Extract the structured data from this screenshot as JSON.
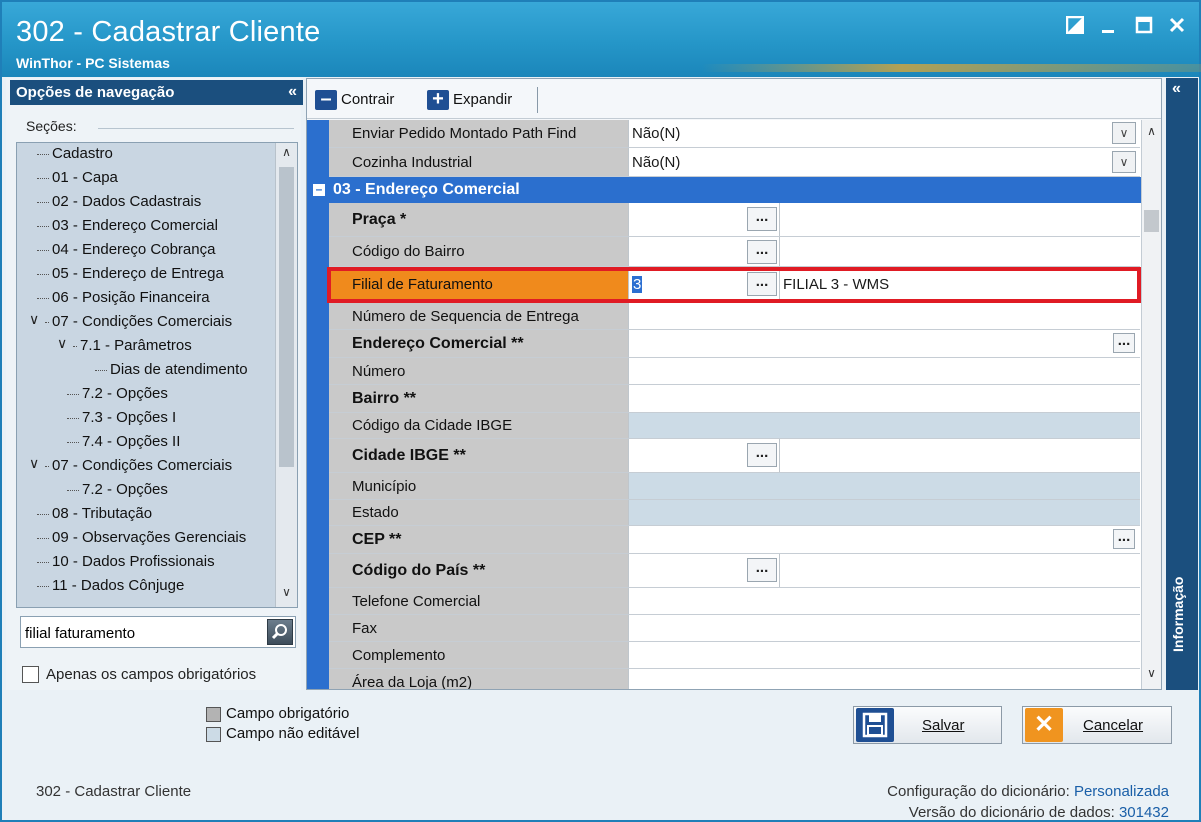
{
  "window": {
    "title": "302 - Cadastrar Cliente",
    "subtitle": "WinThor - PC Sistemas"
  },
  "nav": {
    "header": "Opções de navegação",
    "sections_label": "Seções:",
    "tree": [
      {
        "label": "Cadastro"
      },
      {
        "label": "01 - Capa"
      },
      {
        "label": "02 - Dados Cadastrais"
      },
      {
        "label": "03 - Endereço Comercial"
      },
      {
        "label": "04 - Endereço Cobrança"
      },
      {
        "label": "05 - Endereço de Entrega"
      },
      {
        "label": "06 - Posição Financeira"
      },
      {
        "label": "07 - Condições Comerciais"
      },
      {
        "label": "7.1 - Parâmetros"
      },
      {
        "label": "Dias de atendimento"
      },
      {
        "label": "7.2 - Opções"
      },
      {
        "label": "7.3 - Opções I"
      },
      {
        "label": "7.4 - Opções II"
      },
      {
        "label": "07 - Condições Comerciais"
      },
      {
        "label": "7.2 - Opções"
      },
      {
        "label": "08 - Tributação"
      },
      {
        "label": "09 - Observações Gerenciais"
      },
      {
        "label": "10 - Dados Profissionais"
      },
      {
        "label": "11 - Dados Cônjuge"
      }
    ],
    "search_value": "filial faturamento",
    "only_required_label": "Apenas os campos obrigatórios"
  },
  "toolbar": {
    "collapse_label": "Contrair",
    "expand_label": "Expandir"
  },
  "grid": {
    "rows_top": [
      {
        "label": "Enviar Pedido Montado Path Find",
        "value": "Não(N)"
      },
      {
        "label": "Cozinha Industrial",
        "value": "Não(N)"
      }
    ],
    "section_title": "03 - Endereço Comercial",
    "rows": [
      {
        "label": "Praça *"
      },
      {
        "label": "Código do Bairro"
      },
      {
        "label": "Filial de Faturamento",
        "value": "3",
        "desc": "FILIAL 3 - WMS"
      },
      {
        "label": "Número de Sequencia de Entrega"
      },
      {
        "label": "Endereço Comercial **"
      },
      {
        "label": "Número"
      },
      {
        "label": "Bairro **"
      },
      {
        "label": "Código da Cidade IBGE"
      },
      {
        "label": "Cidade IBGE **"
      },
      {
        "label": "Município"
      },
      {
        "label": "Estado"
      },
      {
        "label": "CEP **"
      },
      {
        "label": "Código do País **"
      },
      {
        "label": "Telefone Comercial"
      },
      {
        "label": "Fax"
      },
      {
        "label": "Complemento"
      },
      {
        "label": "Área da Loja (m2)"
      }
    ],
    "ellipsis": "..."
  },
  "info_tab": {
    "label": "Informação"
  },
  "legend": {
    "required": "Campo obrigatório",
    "not_editable": "Campo não editável"
  },
  "buttons": {
    "save": "Salvar",
    "cancel": "Cancelar"
  },
  "footer": {
    "left": "302 - Cadastrar Cliente",
    "dict_config_label": "Configuração do dicionário:",
    "dict_config_value": "Personalizada",
    "dict_version_label": "Versão do dicionário de dados:",
    "dict_version_value": "301432"
  },
  "colors": {
    "title_bar": "#2596c8",
    "nav_header": "#1b4f7e",
    "section_blue": "#2b6fce",
    "highlight_orange": "#f08a1c",
    "highlight_frame": "#e01b24"
  }
}
